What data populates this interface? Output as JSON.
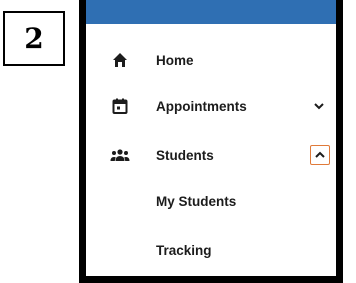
{
  "step": "2",
  "colors": {
    "topbar": "#2f6fb3",
    "text": "#1c1c1c",
    "focus_border": "#e07a3a"
  },
  "menu": {
    "items": [
      {
        "label": "Home",
        "icon": "home-icon"
      },
      {
        "label": "Appointments",
        "icon": "calendar-icon",
        "chevron": "chevron-down-icon"
      },
      {
        "label": "Students",
        "icon": "people-icon",
        "chevron": "chevron-up-icon"
      },
      {
        "label": "My Students"
      },
      {
        "label": "Tracking"
      }
    ]
  }
}
